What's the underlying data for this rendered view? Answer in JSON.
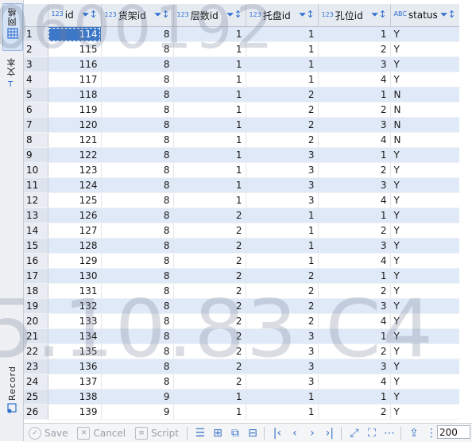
{
  "side_tabs": {
    "grid_label": "网格",
    "text_label": "文本",
    "record_label": "Record"
  },
  "columns": [
    {
      "type": "123",
      "label": "id"
    },
    {
      "type": "123",
      "label": "货架id"
    },
    {
      "type": "123",
      "label": "层数id"
    },
    {
      "type": "123",
      "label": "托盘id"
    },
    {
      "type": "123",
      "label": "孔位id"
    },
    {
      "type": "ABC",
      "label": "status"
    }
  ],
  "rows": [
    [
      "1",
      "114",
      "8",
      "1",
      "1",
      "1",
      "Y"
    ],
    [
      "2",
      "115",
      "8",
      "1",
      "1",
      "2",
      "Y"
    ],
    [
      "3",
      "116",
      "8",
      "1",
      "1",
      "3",
      "Y"
    ],
    [
      "4",
      "117",
      "8",
      "1",
      "1",
      "4",
      "Y"
    ],
    [
      "5",
      "118",
      "8",
      "1",
      "2",
      "1",
      "N"
    ],
    [
      "6",
      "119",
      "8",
      "1",
      "2",
      "2",
      "N"
    ],
    [
      "7",
      "120",
      "8",
      "1",
      "2",
      "3",
      "N"
    ],
    [
      "8",
      "121",
      "8",
      "1",
      "2",
      "4",
      "N"
    ],
    [
      "9",
      "122",
      "8",
      "1",
      "3",
      "1",
      "Y"
    ],
    [
      "10",
      "123",
      "8",
      "1",
      "3",
      "2",
      "Y"
    ],
    [
      "11",
      "124",
      "8",
      "1",
      "3",
      "3",
      "Y"
    ],
    [
      "12",
      "125",
      "8",
      "1",
      "3",
      "4",
      "Y"
    ],
    [
      "13",
      "126",
      "8",
      "2",
      "1",
      "1",
      "Y"
    ],
    [
      "14",
      "127",
      "8",
      "2",
      "1",
      "2",
      "Y"
    ],
    [
      "15",
      "128",
      "8",
      "2",
      "1",
      "3",
      "Y"
    ],
    [
      "16",
      "129",
      "8",
      "2",
      "1",
      "4",
      "Y"
    ],
    [
      "17",
      "130",
      "8",
      "2",
      "2",
      "1",
      "Y"
    ],
    [
      "18",
      "131",
      "8",
      "2",
      "2",
      "2",
      "Y"
    ],
    [
      "19",
      "132",
      "8",
      "2",
      "2",
      "3",
      "Y"
    ],
    [
      "20",
      "133",
      "8",
      "2",
      "2",
      "4",
      "Y"
    ],
    [
      "21",
      "134",
      "8",
      "2",
      "3",
      "1",
      "Y"
    ],
    [
      "22",
      "135",
      "8",
      "2",
      "3",
      "2",
      "Y"
    ],
    [
      "23",
      "136",
      "8",
      "2",
      "3",
      "3",
      "Y"
    ],
    [
      "24",
      "137",
      "8",
      "2",
      "3",
      "4",
      "Y"
    ],
    [
      "25",
      "138",
      "9",
      "1",
      "1",
      "1",
      "Y"
    ],
    [
      "26",
      "139",
      "9",
      "1",
      "1",
      "2",
      "Y"
    ]
  ],
  "toolbar": {
    "save_label": "Save",
    "cancel_label": "Cancel",
    "script_label": "Script",
    "fetch_size": "200"
  },
  "watermarks": {
    "top": "0600192",
    "bottom": "5.10.83 C4"
  },
  "colors": {
    "accent": "#3d77c7",
    "alt_row": "#dfe9f7"
  }
}
